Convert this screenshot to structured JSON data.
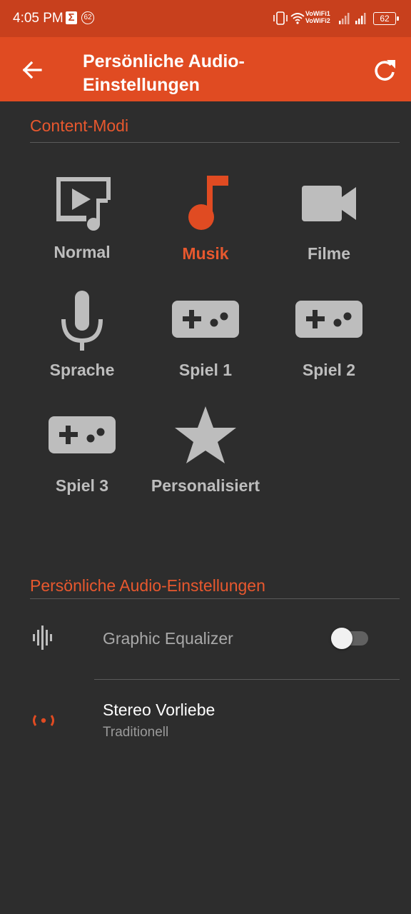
{
  "status_bar": {
    "time": "4:05 PM",
    "notification_badge": "62",
    "vowifi_line1": "VoWiFi1",
    "vowifi_line2": "VoWiFi2",
    "battery": "62"
  },
  "appbar": {
    "title": "Persönliche Audio-Einstellungen",
    "back_icon": "arrow-back-icon",
    "refresh_icon": "refresh-icon"
  },
  "content_modes": {
    "header": "Content-Modi",
    "active": "Musik",
    "items": [
      {
        "label": "Normal",
        "icon": "video-music-icon"
      },
      {
        "label": "Musik",
        "icon": "music-note-icon"
      },
      {
        "label": "Filme",
        "icon": "video-camera-icon"
      },
      {
        "label": "Sprache",
        "icon": "microphone-icon"
      },
      {
        "label": "Spiel 1",
        "icon": "gamepad-icon"
      },
      {
        "label": "Spiel 2",
        "icon": "gamepad-icon"
      },
      {
        "label": "Spiel 3",
        "icon": "gamepad-icon"
      },
      {
        "label": "Personalisiert",
        "icon": "star-icon"
      }
    ]
  },
  "personal_audio": {
    "header": "Persönliche Audio-Einstellungen",
    "equalizer": {
      "title": "Graphic Equalizer",
      "enabled": false
    },
    "stereo": {
      "title": "Stereo Vorliebe",
      "value": "Traditionell"
    }
  },
  "colors": {
    "accent": "#e04b22",
    "status_bar": "#c8401d",
    "background": "#2d2d2d",
    "icon_gray": "#bdbdbd"
  }
}
